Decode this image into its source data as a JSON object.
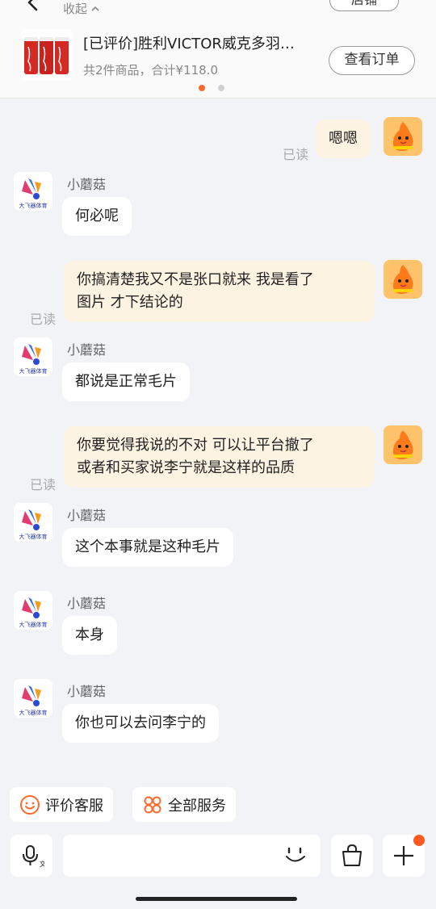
{
  "header": {
    "collapse_label": "收起",
    "shop_button_label": "店铺",
    "product_title": "[已评价]胜利VICTOR威克多羽…",
    "product_summary": "共2件商品，合计¥118.0",
    "order_button_label": "查看订单",
    "colors": {
      "accent": "#ff6a2b",
      "thumb_red": "#d52a24"
    }
  },
  "chat": {
    "read_label": "已读",
    "messages": [
      {
        "from": "me",
        "text": "嗯嗯",
        "read": "已读"
      },
      {
        "from": "shop",
        "sender": "小蘑菇",
        "text": "何必呢"
      },
      {
        "from": "me",
        "line1": "你搞清楚我又不是张口就来 我是看了",
        "line2": "图片 才下结论的",
        "read": "已读"
      },
      {
        "from": "shop",
        "sender": "小蘑菇",
        "text": "都说是正常毛片"
      },
      {
        "from": "me",
        "line1": "你要觉得我说的不对 可以让平台撤了",
        "line2": "或者和买家说李宁就是这样的品质",
        "read": "已读"
      },
      {
        "from": "shop",
        "sender": "小蘑菇",
        "text": "这个本事就是这种毛片"
      },
      {
        "from": "shop",
        "sender": "小蘑菇",
        "text": "本身"
      },
      {
        "from": "shop",
        "sender": "小蘑菇",
        "text": "你也可以去问李宁的"
      }
    ],
    "shop_logo_text": "大飞器体育"
  },
  "bottom": {
    "rate_service_label": "评价客服",
    "all_services_label": "全部服务",
    "input_value": "",
    "icons": [
      "voice-input-icon",
      "emoji-icon",
      "shopping-bag-icon",
      "plus-icon"
    ],
    "colors": {
      "badge": "#ff5a1f"
    }
  }
}
